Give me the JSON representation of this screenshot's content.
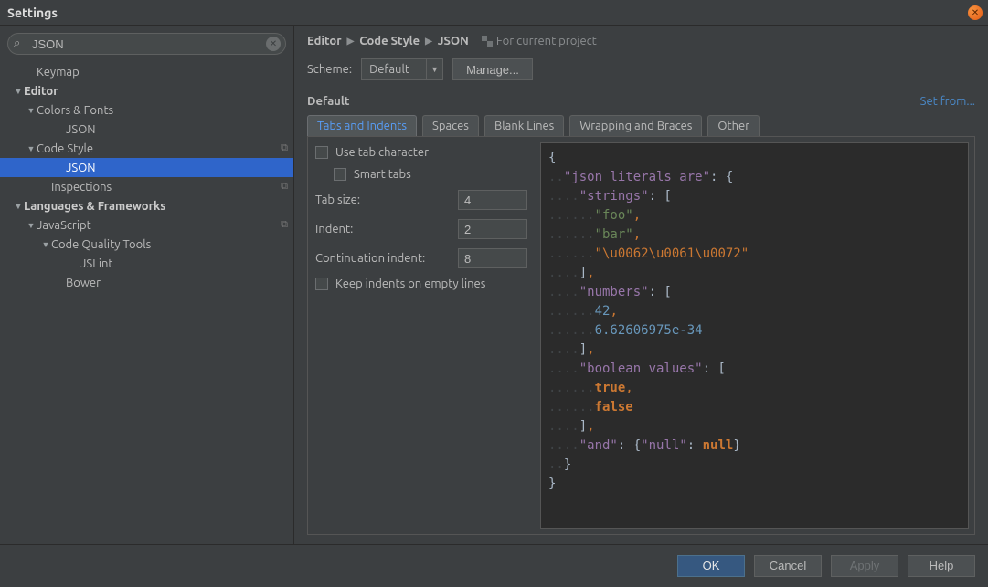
{
  "window": {
    "title": "Settings"
  },
  "search": {
    "value": "JSON"
  },
  "tree": {
    "keymap": "Keymap",
    "editor": "Editor",
    "colors_fonts": "Colors & Fonts",
    "cf_json": "JSON",
    "code_style": "Code Style",
    "cs_json": "JSON",
    "inspections": "Inspections",
    "lang_fw": "Languages & Frameworks",
    "javascript": "JavaScript",
    "cqt": "Code Quality Tools",
    "jslint": "JSLint",
    "bower": "Bower"
  },
  "breadcrumb": {
    "a": "Editor",
    "b": "Code Style",
    "c": "JSON",
    "proj": "For current project"
  },
  "scheme": {
    "label": "Scheme:",
    "value": "Default",
    "manage": "Manage...",
    "name": "Default",
    "setfrom": "Set from..."
  },
  "tabs": {
    "t0": "Tabs and Indents",
    "t1": "Spaces",
    "t2": "Blank Lines",
    "t3": "Wrapping and Braces",
    "t4": "Other"
  },
  "indent": {
    "use_tab": "Use tab character",
    "smart": "Smart tabs",
    "tabsize_label": "Tab size:",
    "tabsize": "4",
    "indent_label": "Indent:",
    "indent": "2",
    "cont_label": "Continuation indent:",
    "cont": "8",
    "keep": "Keep indents on empty lines"
  },
  "preview": {
    "k_lit": "\"json literals are\"",
    "k_str": "\"strings\"",
    "v_foo": "\"foo\"",
    "v_bar": "\"bar\"",
    "v_esc": "\"\\u0062\\u0061\\u0072\"",
    "k_num": "\"numbers\"",
    "v_42": "42",
    "v_planck": "6.62606975e-34",
    "k_bool": "\"boolean values\"",
    "v_true": "true",
    "v_false": "false",
    "k_and": "\"and\"",
    "k_null": "\"null\"",
    "v_null": "null"
  },
  "footer": {
    "ok": "OK",
    "cancel": "Cancel",
    "apply": "Apply",
    "help": "Help"
  }
}
